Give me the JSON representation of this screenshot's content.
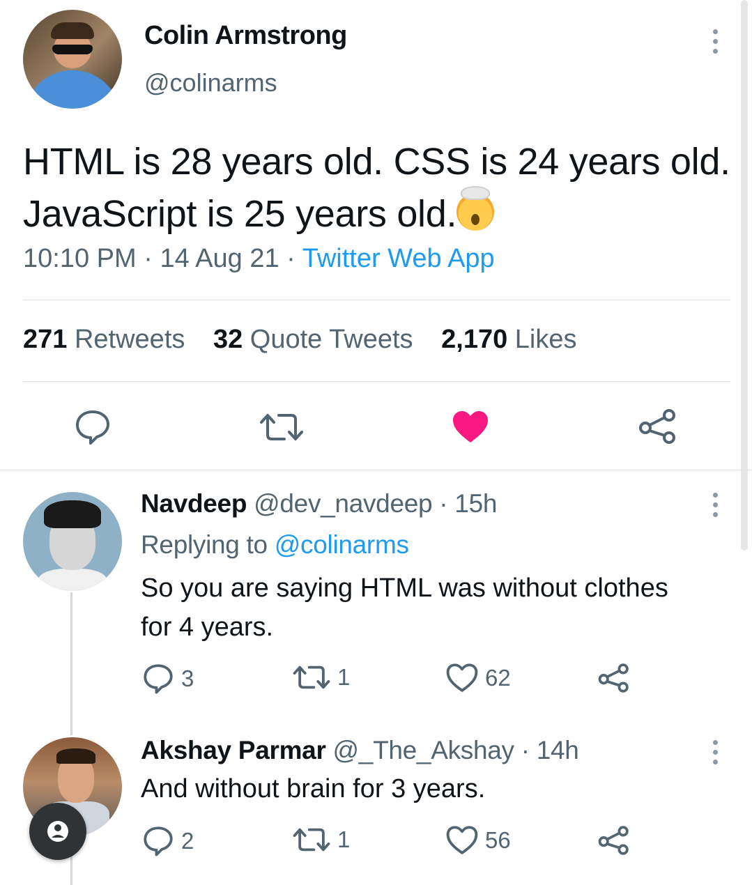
{
  "tweet": {
    "author_name": "Colin Armstrong",
    "author_handle": "@colinarms",
    "text": "HTML is 28 years old. CSS is 24 years old. JavaScript is 25 years old.",
    "emoji": "exploding-head",
    "time": "10:10 PM",
    "date": "14 Aug 21",
    "separator": "·",
    "source": "Twitter Web App",
    "stats": {
      "retweets_count": "271",
      "retweets_label": "Retweets",
      "quotes_count": "32",
      "quotes_label": "Quote Tweets",
      "likes_count": "2,170",
      "likes_label": "Likes"
    },
    "liked": true
  },
  "replies": [
    {
      "name": "Navdeep",
      "handle": "@dev_navdeep",
      "time": "15h",
      "replying_label": "Replying to",
      "replying_to": "@colinarms",
      "text_line1": "So you are saying HTML was without clothes",
      "text_line2": "for 4 years.",
      "replies": "3",
      "retweets": "1",
      "likes": "62"
    },
    {
      "name": "Akshay Parmar",
      "handle": "@_The_Akshay",
      "time": "14h",
      "text_line1": "And without brain for 3 years.",
      "replies": "2",
      "retweets": "1",
      "likes": "56"
    }
  ],
  "colors": {
    "accent": "#1d9bf0",
    "like_red": "#f91880",
    "muted": "#536471",
    "divider": "#dfe3e6"
  }
}
